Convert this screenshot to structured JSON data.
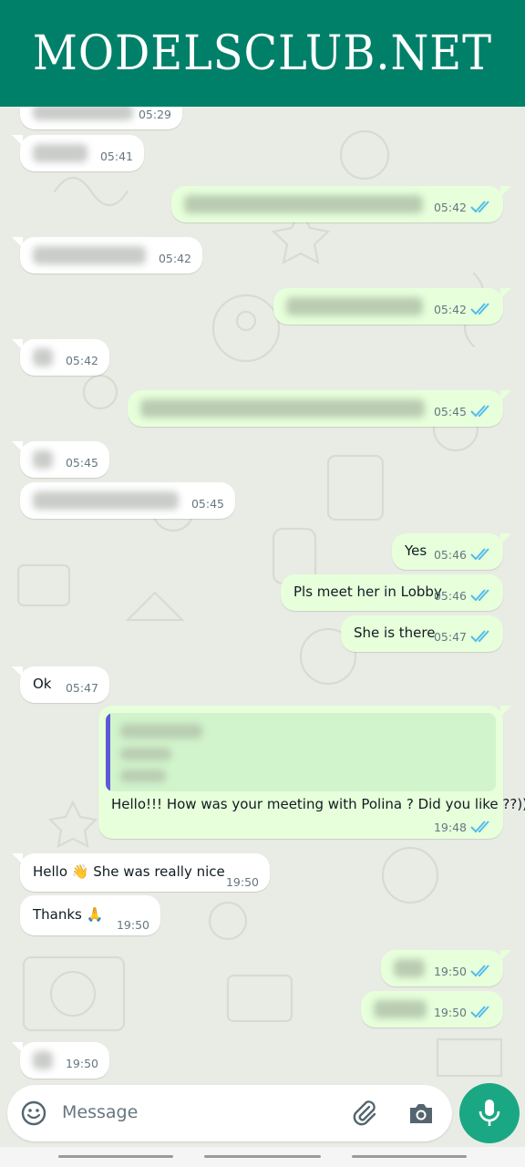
{
  "banner": {
    "text": "MODELSCLUB.NET"
  },
  "colors": {
    "header_green": "#008069",
    "incoming_bubble": "#ffffff",
    "outgoing_bubble": "#e7ffdb",
    "read_ticks": "#53bdeb",
    "mic_button": "#1aa884",
    "quote_bar": "#5e5ad6"
  },
  "messages": [
    {
      "direction": "incoming",
      "blurred": true,
      "time": "05:29"
    },
    {
      "direction": "incoming",
      "blurred": true,
      "time": "05:41"
    },
    {
      "direction": "outgoing",
      "blurred": true,
      "time": "05:42",
      "status": "read"
    },
    {
      "direction": "incoming",
      "blurred": true,
      "time": "05:42"
    },
    {
      "direction": "outgoing",
      "blurred": true,
      "time": "05:42",
      "status": "read"
    },
    {
      "direction": "incoming",
      "blurred": true,
      "time": "05:42"
    },
    {
      "direction": "outgoing",
      "blurred": true,
      "time": "05:45",
      "status": "read"
    },
    {
      "direction": "incoming",
      "blurred": true,
      "time": "05:45"
    },
    {
      "direction": "incoming",
      "blurred": true,
      "time": "05:45"
    },
    {
      "direction": "outgoing",
      "text": "Yes",
      "time": "05:46",
      "status": "read"
    },
    {
      "direction": "outgoing",
      "text": "Pls meet her in Lobby",
      "time": "05:46",
      "status": "read"
    },
    {
      "direction": "outgoing",
      "text": "She is there",
      "time": "05:47",
      "status": "read"
    },
    {
      "direction": "incoming",
      "text": "Ok",
      "time": "05:47"
    },
    {
      "direction": "outgoing",
      "quoted": true,
      "text": "Hello!!! How was your meeting with Polina ? Did you like ??))",
      "time": "19:48",
      "status": "read"
    },
    {
      "direction": "incoming",
      "text_before": "Hello",
      "emoji": "👋",
      "text_after": "She was really nice",
      "time": "19:50"
    },
    {
      "direction": "incoming",
      "text": "Thanks",
      "emoji": "🙏",
      "time": "19:50"
    },
    {
      "direction": "outgoing",
      "blurred": true,
      "time": "19:50",
      "status": "read"
    },
    {
      "direction": "outgoing",
      "blurred": true,
      "time": "19:50",
      "status": "read"
    },
    {
      "direction": "incoming",
      "blurred": true,
      "time": "19:50"
    }
  ],
  "composer": {
    "placeholder": "Message",
    "emoji_icon": "emoji-icon",
    "attach_icon": "paperclip-icon",
    "camera_icon": "camera-icon",
    "mic_icon": "microphone-icon"
  }
}
